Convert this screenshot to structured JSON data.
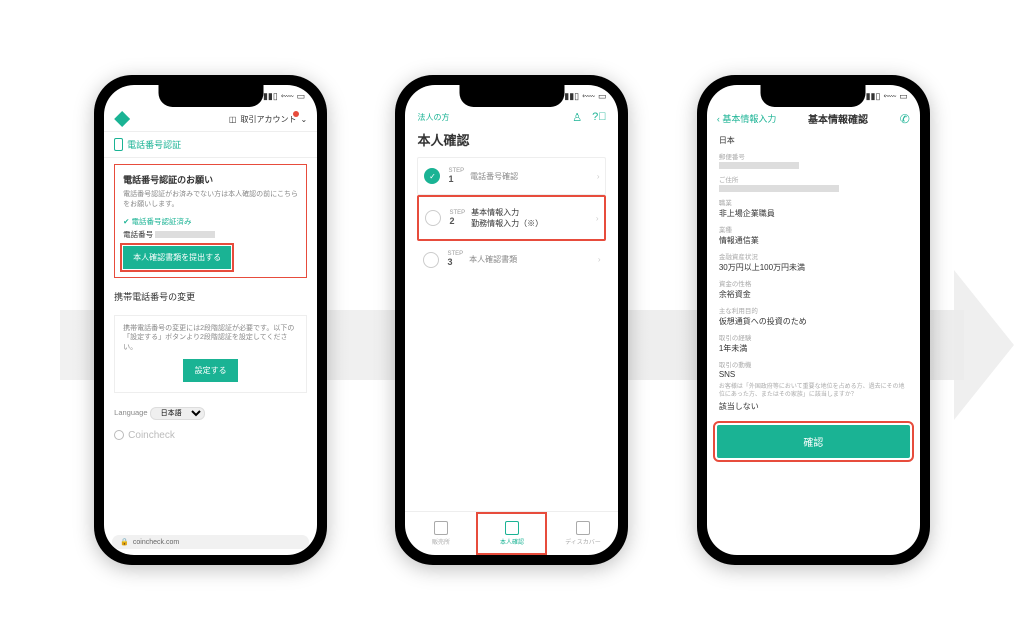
{
  "phone1": {
    "account_label": "取引アカウント",
    "section_title": "電話番号認証",
    "card1_title": "電話番号認証のお願い",
    "card1_body": "電話番号認証がお済みでない方は本人確認の前にこちらをお願いします。",
    "verified": "電話番号認証済み",
    "phone_label": "電話番号",
    "submit_btn": "本人確認書類を提出する",
    "section2_title": "携帯電話番号の変更",
    "card2_body": "携帯電話番号の変更には2段階認証が必要です。以下の「設定する」ボタンより2段階認証を設定してください。",
    "config_btn": "設定する",
    "lang_label": "Language",
    "lang_value": "日本語",
    "brand": "Coincheck",
    "url": "coincheck.com"
  },
  "phone2": {
    "corp_link": "法人の方",
    "title": "本人確認",
    "steps": [
      {
        "n": "1",
        "label": "電話番号確認",
        "done": true
      },
      {
        "n": "2",
        "label": "基本情報入力\n勤務情報入力（※）",
        "done": false,
        "active": true
      },
      {
        "n": "3",
        "label": "本人確認書類",
        "done": false
      }
    ],
    "tabs": [
      {
        "label": "販売所"
      },
      {
        "label": "本人確認",
        "active": true
      },
      {
        "label": "ディスカバー"
      }
    ]
  },
  "phone3": {
    "back": "基本情報入力",
    "title": "基本情報確認",
    "country": "日本",
    "rows": [
      {
        "lbl": "郵便番号"
      },
      {
        "lbl": "ご住所"
      },
      {
        "lbl": "職業",
        "val": "非上場企業職員"
      },
      {
        "lbl": "業種",
        "val": "情報通信業"
      },
      {
        "lbl": "金融資産状況",
        "val": "30万円以上100万円未満"
      },
      {
        "lbl": "資金の性格",
        "val": "余裕資金"
      },
      {
        "lbl": "主な利用目的",
        "val": "仮想通貨への投資のため"
      },
      {
        "lbl": "取引の経験",
        "val": "1年未満"
      },
      {
        "lbl": "取引の動機",
        "val": "SNS"
      }
    ],
    "pep_q": "お客様は「外国政府等において重要な地位を占める方、過去にその地位にあった方、またはその家族」に該当しますか？",
    "pep_a": "該当しない",
    "confirm": "確認"
  }
}
